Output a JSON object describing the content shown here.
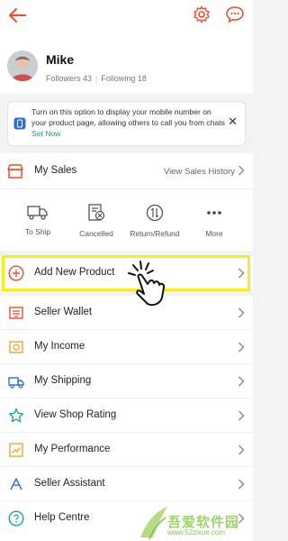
{
  "header": {
    "back_icon": "arrow-left-icon",
    "settings_icon": "gear-icon",
    "chat_icon": "chat-bubble-icon",
    "accent_color": "#ee4d2d"
  },
  "profile": {
    "name": "Mike",
    "followers_label": "Followers 43",
    "following_label": "Following 18"
  },
  "notice": {
    "text": "Turn on this option to display your mobile number on your product page, allowing others to call you from chats",
    "link": "Set Now",
    "close": "✕"
  },
  "sales": {
    "label": "My Sales",
    "history_link": "View Sales History",
    "statuses": [
      {
        "label": "To Ship",
        "icon": "truck-icon"
      },
      {
        "label": "Cancelled",
        "icon": "cancelled-doc-icon"
      },
      {
        "label": "Return/Refund",
        "icon": "return-refund-icon"
      },
      {
        "label": "More",
        "icon": "more-dots-icon"
      }
    ]
  },
  "menu": [
    {
      "label": "Add New Product",
      "icon": "plus-circle-icon"
    },
    {
      "label": "Seller Wallet",
      "icon": "wallet-icon"
    },
    {
      "label": "My Income",
      "icon": "income-icon"
    },
    {
      "label": "My Shipping",
      "icon": "shipping-truck-icon"
    },
    {
      "label": "View Shop Rating",
      "icon": "star-icon"
    },
    {
      "label": "My Performance",
      "icon": "performance-chart-icon"
    },
    {
      "label": "Seller Assistant",
      "icon": "assistant-icon"
    },
    {
      "label": "Help Centre",
      "icon": "help-icon"
    }
  ],
  "watermark": {
    "brand": "吾爱软件园",
    "url": "www.52zixue.com"
  }
}
